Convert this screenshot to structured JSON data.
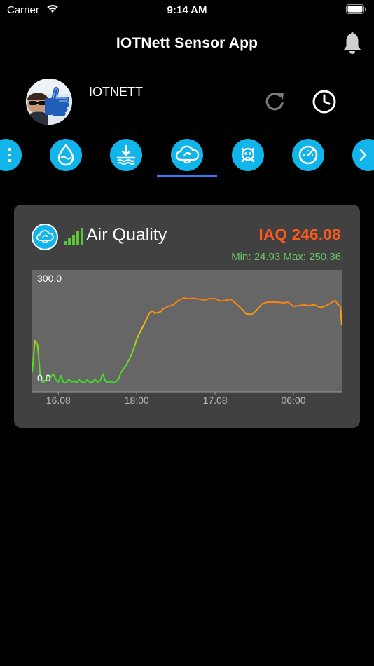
{
  "status_bar": {
    "carrier": "Carrier",
    "time": "9:14 AM"
  },
  "header": {
    "title": "IOTNett Sensor App"
  },
  "profile": {
    "name": "IOTNETT"
  },
  "tabs": [
    {
      "icon": "list-icon"
    },
    {
      "icon": "humidity-drop-icon"
    },
    {
      "icon": "water-level-icon"
    },
    {
      "icon": "air-quality-icon",
      "selected": true
    },
    {
      "icon": "toxic-gas-icon"
    },
    {
      "icon": "pressure-gauge-icon"
    },
    {
      "icon": "next-arrow-icon"
    }
  ],
  "card": {
    "title": "Air Quality",
    "value_text": "IAQ 246.08",
    "min_label": "Min:",
    "min_value": "24.93",
    "max_label": "Max:",
    "max_value": "250.36"
  },
  "colors": {
    "accent": "#12b5ea",
    "value": "#ff5a1a",
    "minmax": "#6ac96a",
    "card_bg": "#414141",
    "plot_bg": "#666666"
  },
  "chart_data": {
    "type": "line",
    "y_ticks": [
      "300.0",
      "0.0"
    ],
    "ylim": [
      0,
      300
    ],
    "x_ticks": [
      "16.08",
      "18:00",
      "17.08",
      "06:00"
    ],
    "x_tick_positions_hours": [
      2,
      8,
      14,
      20
    ],
    "xlim": [
      0,
      23.7
    ],
    "series": [
      {
        "x": [
          0.0,
          0.2,
          0.4,
          0.5,
          0.6,
          0.8,
          1.0,
          1.2,
          1.4,
          1.6,
          1.8,
          2.0,
          2.2,
          2.4,
          2.6,
          2.8,
          3.0,
          3.2,
          3.4,
          3.6,
          3.8,
          4.0,
          4.2,
          4.4,
          4.6,
          4.8,
          5.0,
          5.2,
          5.4,
          5.6,
          5.8,
          6.0,
          6.2,
          6.4,
          6.6,
          6.8,
          7.0,
          7.2,
          7.4,
          7.6,
          7.8,
          8.0,
          8.2,
          8.4,
          8.6,
          8.8,
          9.0,
          9.2,
          9.4,
          9.6,
          9.8,
          10.0,
          10.4,
          10.8,
          11.2,
          11.6,
          12.0,
          12.4,
          12.8,
          13.2,
          13.6,
          14.0,
          14.4,
          14.8,
          15.2,
          15.6,
          16.0,
          16.4,
          16.8,
          17.2,
          17.6,
          18.0,
          18.4,
          18.8,
          19.2,
          19.6,
          20.0,
          20.4,
          20.8,
          21.2,
          21.6,
          22.0,
          22.4,
          22.8,
          23.2,
          23.4,
          23.6,
          23.7
        ],
        "y": [
          40,
          130,
          120,
          80,
          35,
          10,
          15,
          30,
          25,
          35,
          20,
          12,
          30,
          10,
          10,
          20,
          12,
          15,
          10,
          18,
          12,
          10,
          18,
          12,
          10,
          20,
          12,
          15,
          35,
          15,
          10,
          15,
          10,
          12,
          20,
          40,
          50,
          60,
          75,
          90,
          110,
          135,
          150,
          165,
          180,
          195,
          210,
          215,
          208,
          210,
          212,
          220,
          228,
          232,
          245,
          252,
          250,
          251,
          248,
          246,
          250,
          250,
          243,
          245,
          248,
          236,
          222,
          206,
          205,
          218,
          235,
          240,
          240,
          240,
          238,
          240,
          228,
          230,
          232,
          230,
          233,
          225,
          228,
          236,
          245,
          233,
          228,
          175
        ]
      }
    ]
  }
}
